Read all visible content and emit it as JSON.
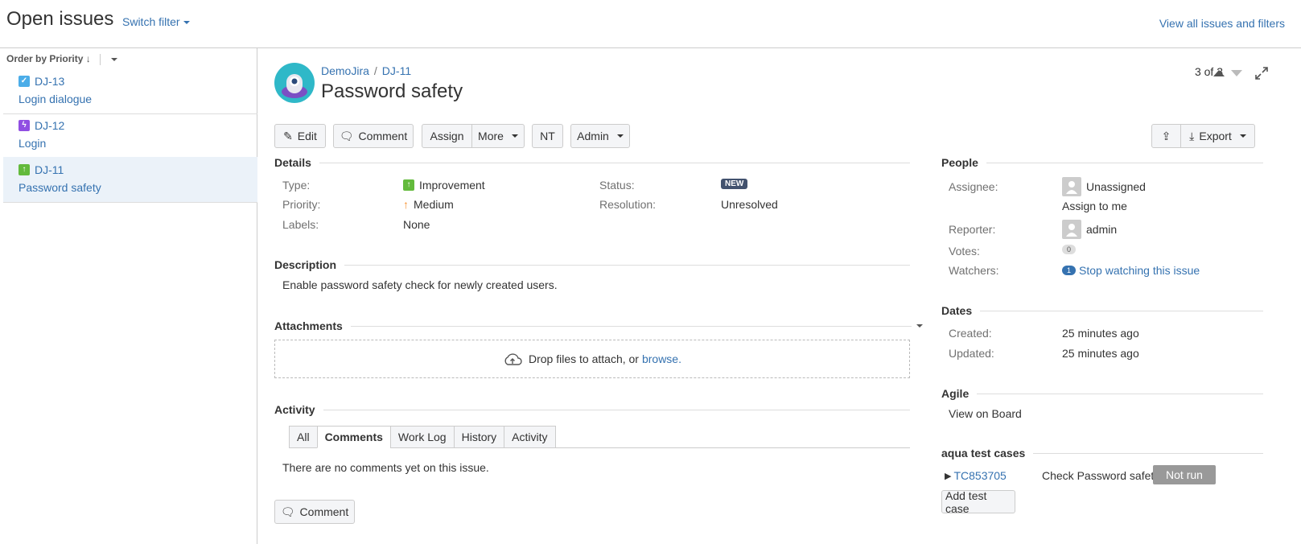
{
  "header": {
    "title": "Open issues",
    "switch_filter": "Switch filter",
    "view_all": "View all issues and filters"
  },
  "sidebar": {
    "order_label": "Order by Priority",
    "issues": [
      {
        "key": "DJ-13",
        "summary": "Login dialogue",
        "type_color": "#4bade8"
      },
      {
        "key": "DJ-12",
        "summary": "Login",
        "type_color": "#904ee2"
      },
      {
        "key": "DJ-11",
        "summary": "Password safety",
        "type_color": "#63ba3c"
      }
    ]
  },
  "issue": {
    "project": "DemoJira",
    "key": "DJ-11",
    "title": "Password safety",
    "pager": "3 of 3"
  },
  "toolbar": {
    "edit": "Edit",
    "comment": "Comment",
    "assign": "Assign",
    "more": "More",
    "nt": "NT",
    "admin": "Admin",
    "export": "Export"
  },
  "details": {
    "heading": "Details",
    "type_label": "Type:",
    "type_value": "Improvement",
    "priority_label": "Priority:",
    "priority_value": "Medium",
    "labels_label": "Labels:",
    "labels_value": "None",
    "status_label": "Status:",
    "status_value": "NEW",
    "resolution_label": "Resolution:",
    "resolution_value": "Unresolved"
  },
  "description": {
    "heading": "Description",
    "text": "Enable password safety check for newly created users."
  },
  "attachments": {
    "heading": "Attachments",
    "drop_text": "Drop files to attach, or",
    "browse": "browse."
  },
  "activity": {
    "heading": "Activity",
    "tabs": [
      "All",
      "Comments",
      "Work Log",
      "History",
      "Activity"
    ],
    "active_tab": "Comments",
    "empty_text": "There are no comments yet on this issue.",
    "comment_button": "Comment"
  },
  "people": {
    "heading": "People",
    "assignee_label": "Assignee:",
    "assignee_value": "Unassigned",
    "assign_to_me": "Assign to me",
    "reporter_label": "Reporter:",
    "reporter_value": "admin",
    "votes_label": "Votes:",
    "votes_value": "0",
    "watchers_label": "Watchers:",
    "watchers_value": "1",
    "stop_watching": "Stop watching this issue"
  },
  "dates": {
    "heading": "Dates",
    "created_label": "Created:",
    "created_value": "25 minutes ago",
    "updated_label": "Updated:",
    "updated_value": "25 minutes ago"
  },
  "agile": {
    "heading": "Agile",
    "view_on_board": "View on Board"
  },
  "aqua": {
    "heading": "aqua test cases",
    "test_id": "TC853705",
    "test_name": "Check Password safety",
    "status": "Not run",
    "add_button": "Add test case"
  }
}
